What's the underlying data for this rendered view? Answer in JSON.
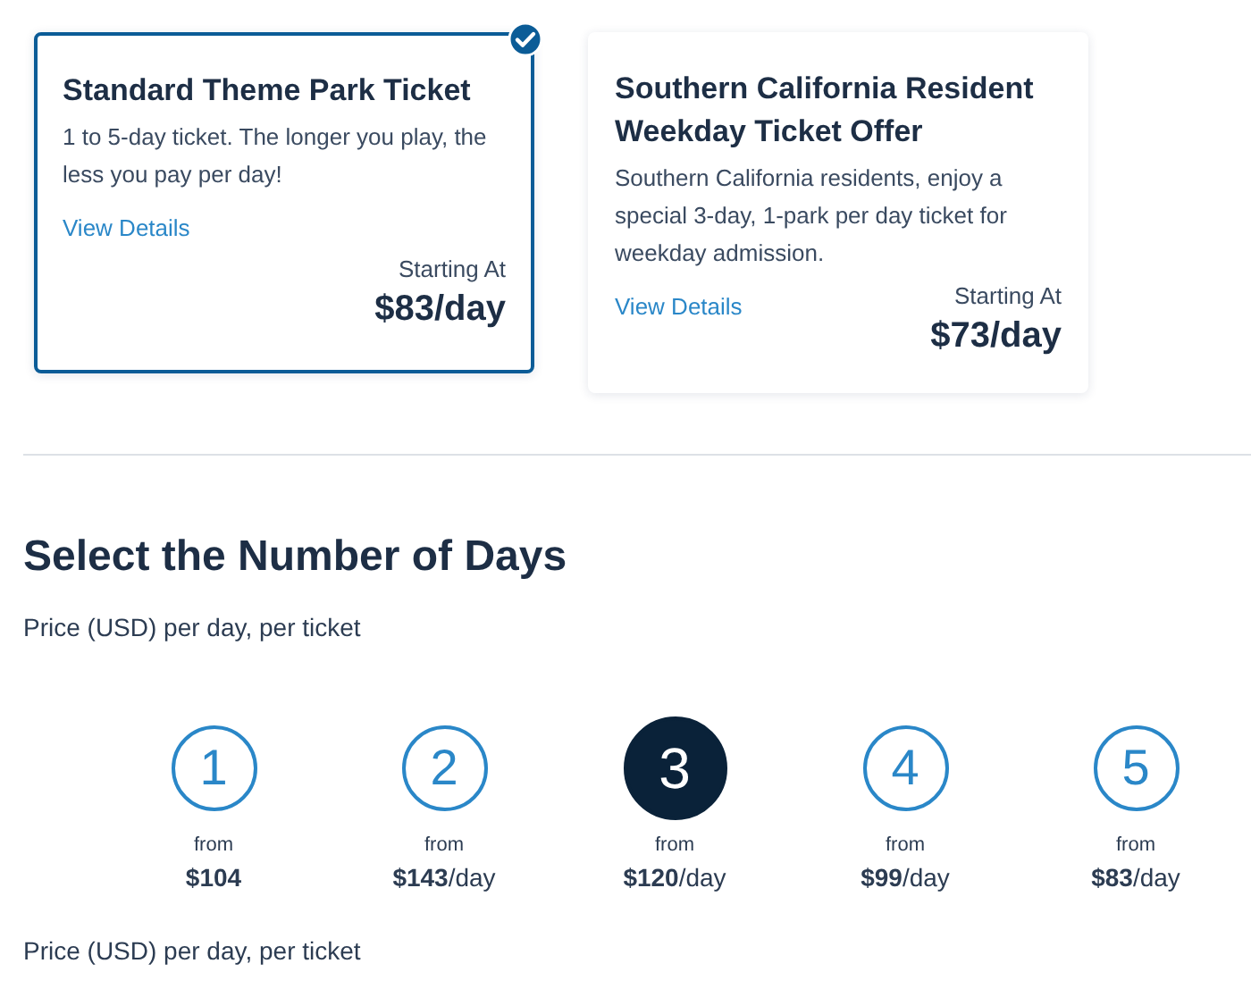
{
  "tickets": [
    {
      "title": "Standard Theme Park Ticket",
      "description": "1 to 5-day ticket. The longer you play, the less you pay per day!",
      "link": "View Details",
      "price_label": "Starting At",
      "price": "$83/day",
      "selected": true
    },
    {
      "title": "Southern California Resident Weekday Ticket Offer",
      "description": "Southern California residents, enjoy a special 3-day, 1-park per day ticket for weekday admission.",
      "link": "View Details",
      "price_label": "Starting At",
      "price": "$73/day",
      "selected": false
    }
  ],
  "heading": "Select the Number of Days",
  "subtitle": "Price (USD) per day, per ticket",
  "days": [
    {
      "number": "1",
      "from": "from",
      "price": "**$104**",
      "selected": false
    },
    {
      "number": "2",
      "from": "from",
      "price": "**$143**/day",
      "selected": false
    },
    {
      "number": "3",
      "from": "from",
      "price": "**$120**/day",
      "selected": true
    },
    {
      "number": "4",
      "from": "from",
      "price": "**$99**/day",
      "selected": false
    },
    {
      "number": "5",
      "from": "from",
      "price": "**$83**/day",
      "selected": false
    }
  ],
  "footer_note": "Price (USD) per day, per ticket"
}
